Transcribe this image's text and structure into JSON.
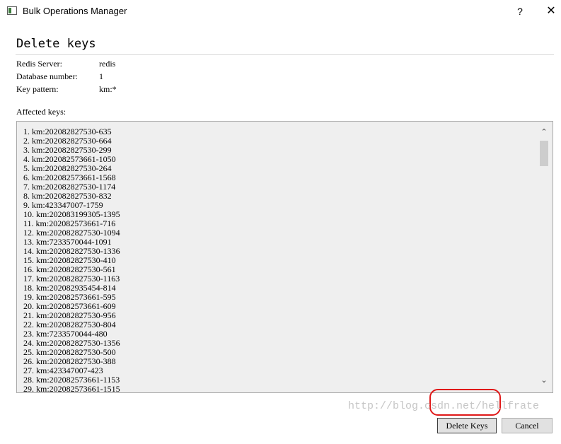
{
  "window": {
    "title": "Bulk Operations Manager",
    "help_label": "?",
    "close_label": "✕"
  },
  "dialog": {
    "heading": "Delete keys",
    "info": [
      {
        "label": "Redis Server:",
        "value": "redis"
      },
      {
        "label": "Database number:",
        "value": "1"
      },
      {
        "label": "Key pattern:",
        "value": "km:*"
      }
    ],
    "affected_label": "Affected keys:",
    "keys": [
      "1. km:202082827530-635",
      "2. km:202082827530-664",
      "3. km:202082827530-299",
      "4. km:202082573661-1050",
      "5. km:202082827530-264",
      "6. km:202082573661-1568",
      "7. km:202082827530-1174",
      "8. km:202082827530-832",
      "9. km:423347007-1759",
      "10. km:202083199305-1395",
      "11. km:202082573661-716",
      "12. km:202082827530-1094",
      "13. km:7233570044-1091",
      "14. km:202082827530-1336",
      "15. km:202082827530-410",
      "16. km:202082827530-561",
      "17. km:202082827530-1163",
      "18. km:202082935454-814",
      "19. km:202082573661-595",
      "20. km:202082573661-609",
      "21. km:202082827530-956",
      "22. km:202082827530-804",
      "23. km:7233570044-480",
      "24. km:202082827530-1356",
      "25. km:202082827530-500",
      "26. km:202082827530-388",
      "27. km:423347007-423",
      "28. km:202082573661-1153",
      "29. km:202082573661-1515"
    ],
    "scroll_up_icon": "chevron-up-icon",
    "scroll_down_icon": "chevron-down-icon",
    "delete_button": "Delete Keys",
    "cancel_button": "Cancel",
    "highlight_color": "#e01818"
  },
  "watermark": "http://blog.csdn.net/hellfrate"
}
